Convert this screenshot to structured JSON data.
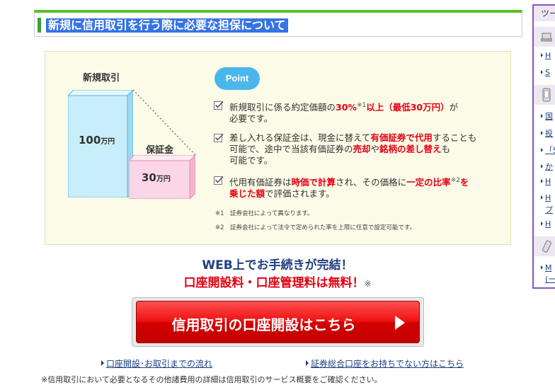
{
  "header": {
    "title": "新規に信用取引を行う際に必要な担保について"
  },
  "figure": {
    "label_new": "新規取引",
    "bar_new_value": "100",
    "bar_new_unit": "万円",
    "label_margin": "保証金",
    "bar_margin_value": "30",
    "bar_margin_unit": "万円",
    "colors": {
      "bar_new": "#c9eefb",
      "bar_margin": "#fbd6e6"
    }
  },
  "point": {
    "badge": "Point",
    "items": [
      {
        "p1": "新規取引に係る約定価額の",
        "r1": "30%",
        "sup": "※1",
        "r2": "以上（最低30万円）",
        "p2": "が",
        "line2": "必要です。"
      },
      {
        "p1": "差し入れる保証金は、現金に替えて",
        "r1": "有価証券で代用",
        "p2": "することも",
        "line2a": "可能で、途中で当該有価証券の",
        "r2": "売却",
        "p3": "や",
        "r3": "銘柄の差し替え",
        "p4": "も",
        "line3": "可能です。"
      },
      {
        "p1": "代用有価証券は",
        "r1": "時価で計算",
        "p2": "され、その価格に",
        "r2": "一定の比率",
        "sup": "※2",
        "r3": "を",
        "r4": "乗じた額",
        "p3": "で評価されます。"
      }
    ],
    "notes": [
      "※1　証券会社によって異なります。",
      "※2　証券会社によって法令で定められた率を上限に任意で設定可能です。"
    ]
  },
  "promo": {
    "line1": "WEB上でお手続きが完結！",
    "line2": "口座開設料・口座管理料は無料！",
    "mark": "※"
  },
  "cta": {
    "label": "信用取引の口座開設はこちら"
  },
  "links": {
    "flow": "口座開設･お取引までの流れ",
    "no_account": "証券総合口座をお持ちでない方はこちら"
  },
  "bottom_note": "※信用取引において必要となるその他諸費用の詳細は信用取引のサービス概要をご確認ください。",
  "sidebar": {
    "head": "ツー",
    "group1": [
      "H",
      "S"
    ],
    "group2": [
      "国",
      "投",
      "「S",
      "か",
      "H",
      "H",
      "プ",
      "H"
    ],
    "group3": [
      "M",
      "(ー"
    ]
  }
}
